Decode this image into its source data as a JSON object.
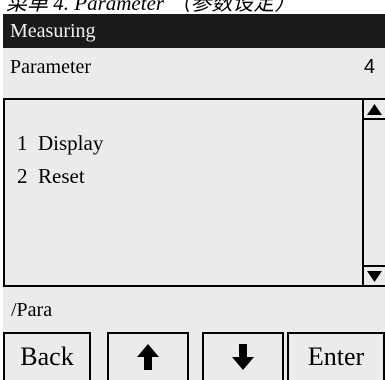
{
  "screen": {
    "title": "Measuring",
    "parameter_label": "Parameter",
    "parameter_number": "4",
    "menu_items": [
      "1  Display",
      "2  Reset"
    ],
    "path": "/Para",
    "icons": {
      "scroll_up": "triangle-up",
      "scroll_down": "triangle-down",
      "key_up": "arrow-up",
      "key_down": "arrow-down"
    }
  },
  "softkeys": {
    "back": "Back",
    "enter": "Enter"
  }
}
